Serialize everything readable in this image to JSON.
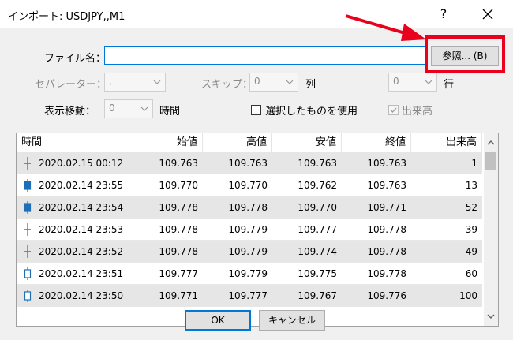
{
  "window": {
    "title": "インポート: USDJPY,,M1",
    "help": "?",
    "close": "✕"
  },
  "form": {
    "file_label": "ファイル名：",
    "file_value": "",
    "browse_label": "参照... (B)",
    "separator_label": "セパレーター：",
    "separator_value": ",",
    "skip_label": "スキップ：",
    "skip_value": "0",
    "col_label": "列",
    "row_value": "0",
    "row_label": "行",
    "shift_label": "表示移動：",
    "shift_value": "0",
    "hours_label": "時間",
    "use_selected_label": "選択したものを使用",
    "volume_label": "出来高"
  },
  "table": {
    "headers": [
      "時間",
      "始値",
      "高値",
      "安値",
      "終値",
      "出来高"
    ],
    "rows": [
      {
        "icon": "doji",
        "time": "2020.02.15 00:12",
        "open": "109.763",
        "high": "109.763",
        "low": "109.763",
        "close": "109.763",
        "volume": "1"
      },
      {
        "icon": "bull",
        "time": "2020.02.14 23:55",
        "open": "109.770",
        "high": "109.770",
        "low": "109.762",
        "close": "109.763",
        "volume": "13"
      },
      {
        "icon": "bull",
        "time": "2020.02.14 23:54",
        "open": "109.778",
        "high": "109.778",
        "low": "109.770",
        "close": "109.771",
        "volume": "52"
      },
      {
        "icon": "doji",
        "time": "2020.02.14 23:53",
        "open": "109.778",
        "high": "109.779",
        "low": "109.777",
        "close": "109.778",
        "volume": "39"
      },
      {
        "icon": "doji",
        "time": "2020.02.14 23:52",
        "open": "109.778",
        "high": "109.779",
        "low": "109.774",
        "close": "109.778",
        "volume": "49"
      },
      {
        "icon": "bear",
        "time": "2020.02.14 23:51",
        "open": "109.777",
        "high": "109.779",
        "low": "109.775",
        "close": "109.778",
        "volume": "60"
      },
      {
        "icon": "bear",
        "time": "2020.02.14 23:50",
        "open": "109.771",
        "high": "109.777",
        "low": "109.767",
        "close": "109.776",
        "volume": "100"
      }
    ]
  },
  "footer": {
    "ok_label": "OK",
    "cancel_label": "キャンセル"
  },
  "colors": {
    "highlight": "#e8001c",
    "arrow": "#e8001c",
    "focus": "#0078d7",
    "candle": "#1f6fb8"
  }
}
